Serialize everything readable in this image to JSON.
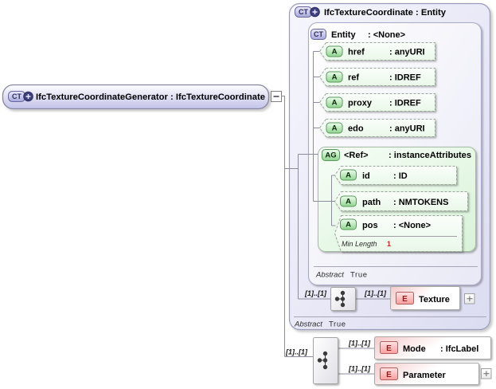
{
  "icons": {
    "complex_type": "CT",
    "attribute": "A",
    "attribute_group": "AG",
    "element": "E"
  },
  "main_element": {
    "label": "IfcTextureCoordinateGenerator : IfcTextureCoordinate"
  },
  "type_box": {
    "title": "IfcTextureCoordinate : Entity",
    "abstract_facet": {
      "label": "Abstract",
      "value": "True"
    },
    "base_type_box": {
      "name": "Entity",
      "type": ": <None>",
      "abstract_facet": {
        "label": "Abstract",
        "value": "True"
      },
      "attributes": [
        {
          "name": "href",
          "type": ": anyURI"
        },
        {
          "name": "ref",
          "type": ": IDREF"
        },
        {
          "name": "proxy",
          "type": ": IDREF"
        },
        {
          "name": "edo",
          "type": ": anyURI"
        }
      ],
      "attribute_group": {
        "name": "<Ref>",
        "type": ": instanceAttributes",
        "attributes": [
          {
            "name": "id",
            "type": ": ID"
          },
          {
            "name": "path",
            "type": ": NMTOKENS"
          },
          {
            "name": "pos",
            "type": ": <None>",
            "facet": {
              "label": "Min Length",
              "value": "1"
            }
          }
        ]
      }
    },
    "sequence": {
      "cardinality": "[1]..[1]",
      "element_cardinality": "[1]..[1]",
      "element": {
        "name": "Texture"
      }
    }
  },
  "content_model": {
    "cardinality": "[1]..[1]",
    "children": [
      {
        "cardinality": "[1]..[1]",
        "name": "Mode",
        "type": ": IfcLabel"
      },
      {
        "cardinality": "[1]..[1]",
        "name": "Parameter"
      }
    ]
  }
}
